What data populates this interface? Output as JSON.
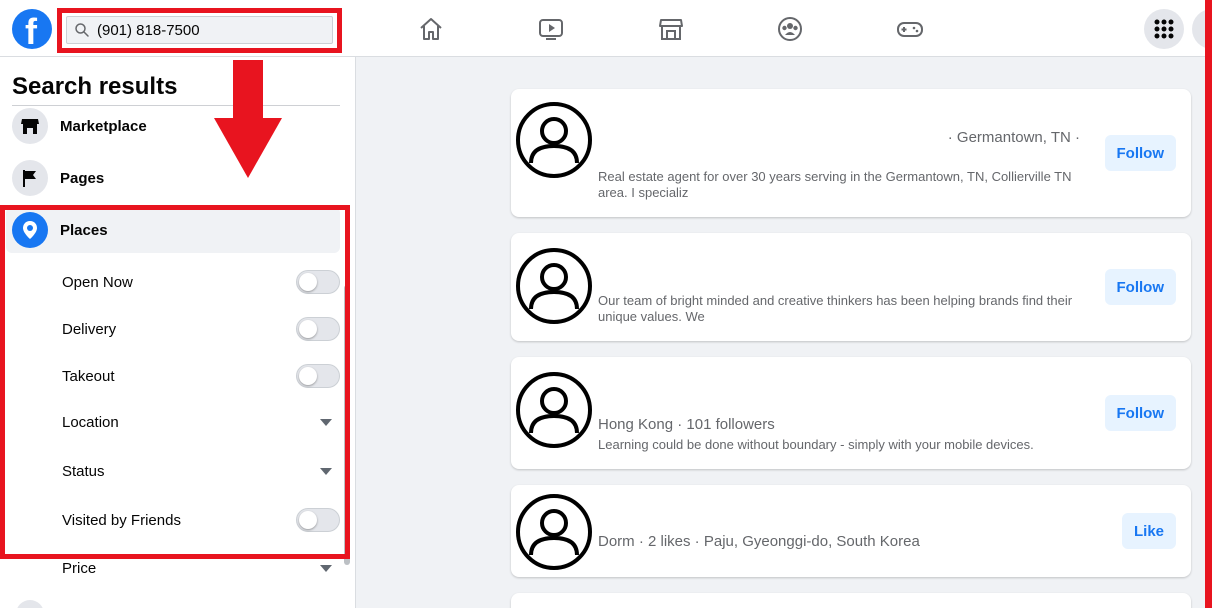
{
  "header": {
    "logo_letter": "f",
    "search_value": "(901) 818-7500",
    "nav_icons": [
      "home-icon",
      "watch-icon",
      "marketplace-icon",
      "groups-icon",
      "gaming-icon"
    ]
  },
  "sidebar": {
    "title": "Search results",
    "categories": [
      {
        "label": "Marketplace",
        "icon": "shop-icon"
      },
      {
        "label": "Pages",
        "icon": "flag-icon"
      },
      {
        "label": "Places",
        "icon": "location-pin-icon",
        "active": true
      }
    ],
    "filters": [
      {
        "label": "Open Now",
        "type": "toggle",
        "on": false
      },
      {
        "label": "Delivery",
        "type": "toggle",
        "on": false
      },
      {
        "label": "Takeout",
        "type": "toggle",
        "on": false
      },
      {
        "label": "Location",
        "type": "dropdown"
      },
      {
        "label": "Status",
        "type": "dropdown"
      },
      {
        "label": "Visited by Friends",
        "type": "toggle",
        "on": false
      },
      {
        "label": "Price",
        "type": "dropdown"
      }
    ]
  },
  "results": [
    {
      "meta": "· Germantown, TN ·",
      "desc": "Real estate agent for over 30 years serving in the Germantown, TN, Collierville TN area. I specializ",
      "action": "Follow"
    },
    {
      "meta": "",
      "desc": "Our team of bright minded and creative thinkers has been helping brands find their unique values. We",
      "action": "Follow"
    },
    {
      "meta": "Hong Kong · 101 followers",
      "desc": "Learning could be done without boundary - simply with your mobile devices.",
      "action": "Follow"
    },
    {
      "meta": "Dorm · 2 likes · Paju, Gyeonggi-do, South Korea",
      "desc": "",
      "action": "Like"
    }
  ],
  "colors": {
    "accent": "#1877f2",
    "annotation": "#e8141f"
  }
}
